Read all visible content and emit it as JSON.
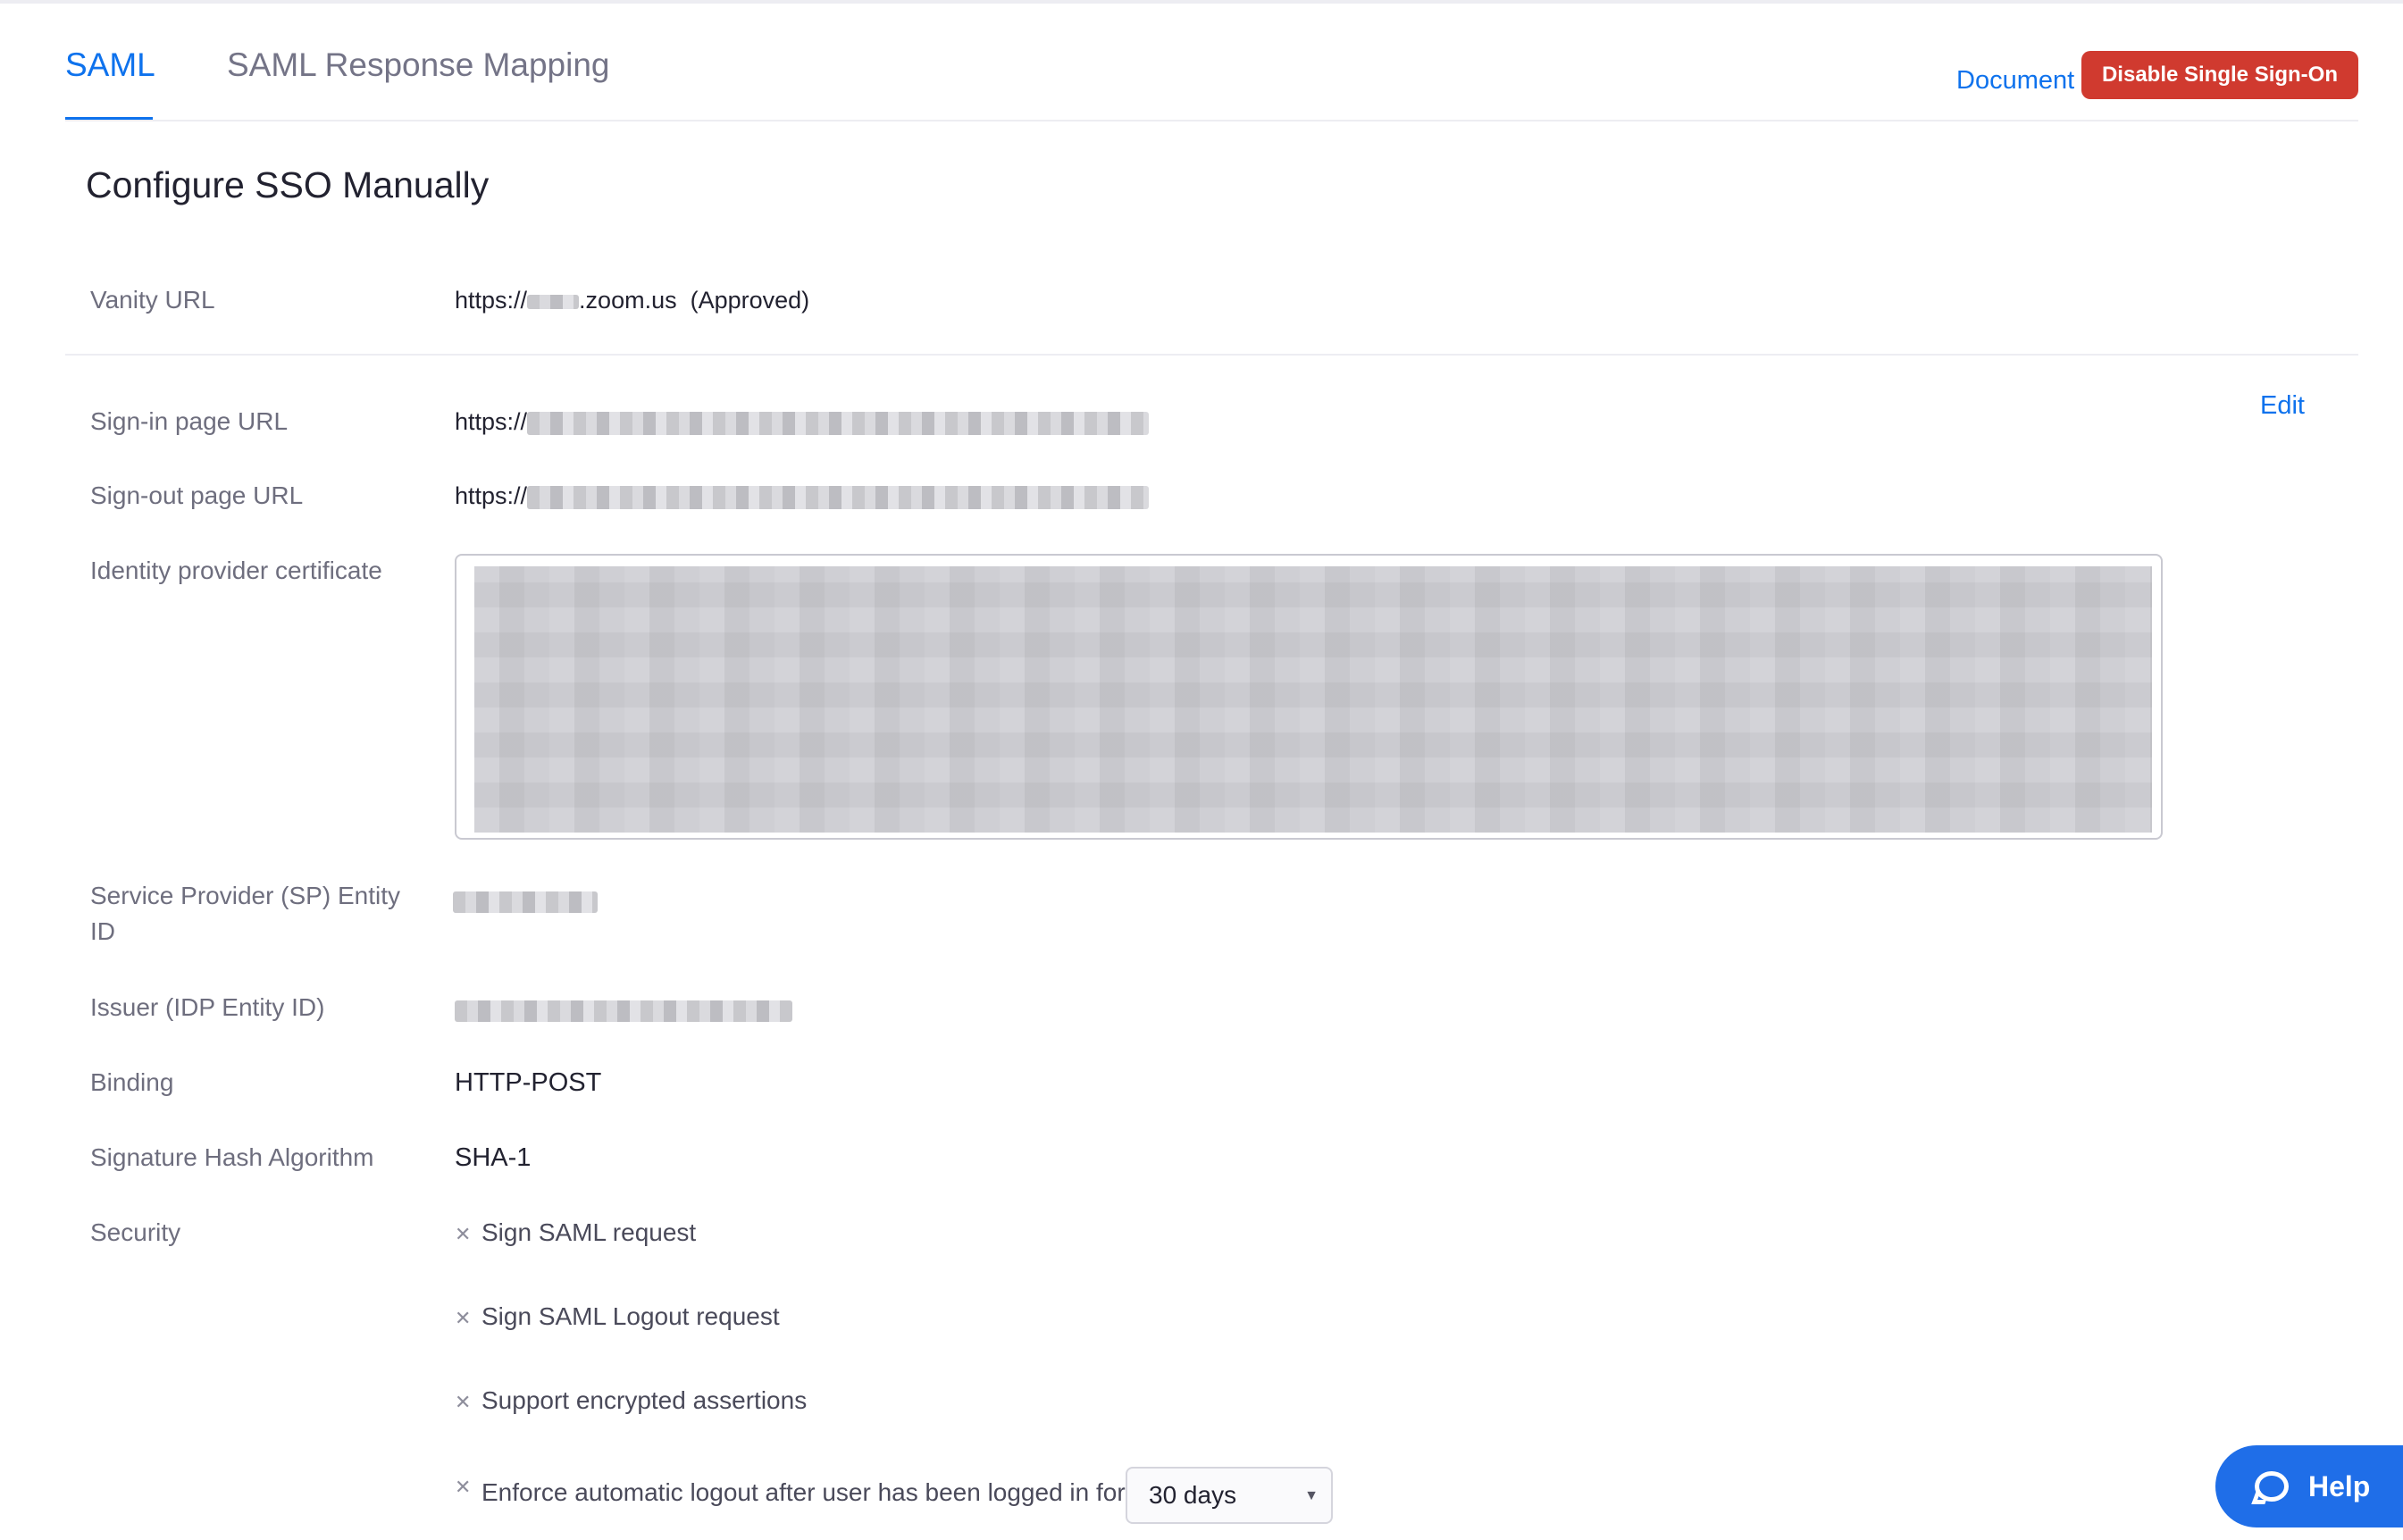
{
  "tabs": [
    {
      "label": "SAML",
      "active": true
    },
    {
      "label": "SAML Response Mapping",
      "active": false
    }
  ],
  "header": {
    "document_link": "Document",
    "disable_button": "Disable Single Sign-On"
  },
  "section_title": "Configure SSO Manually",
  "vanity_url": {
    "label": "Vanity URL",
    "prefix": "https://",
    "suffix": ".zoom.us",
    "status": "(Approved)"
  },
  "edit_link": "Edit",
  "fields": {
    "signin": {
      "label": "Sign-in page URL",
      "prefix": "https://"
    },
    "signout": {
      "label": "Sign-out page URL",
      "prefix": "https://"
    },
    "certificate": {
      "label": "Identity provider certificate"
    },
    "sp_entity": {
      "label": "Service Provider (SP) Entity ID"
    },
    "issuer": {
      "label": "Issuer (IDP Entity ID)"
    },
    "binding": {
      "label": "Binding",
      "value": "HTTP-POST"
    },
    "hash": {
      "label": "Signature Hash Algorithm",
      "value": "SHA-1"
    },
    "security": {
      "label": "Security"
    }
  },
  "security_options": [
    "Sign SAML request",
    "Sign SAML Logout request",
    "Support encrypted assertions",
    "Enforce automatic logout after user has been logged in for"
  ],
  "logout_select": {
    "value": "30 days"
  },
  "help_button": "Help",
  "colors": {
    "accent": "#0e72ed",
    "danger": "#d03a2f",
    "help": "#1f6ee8"
  }
}
